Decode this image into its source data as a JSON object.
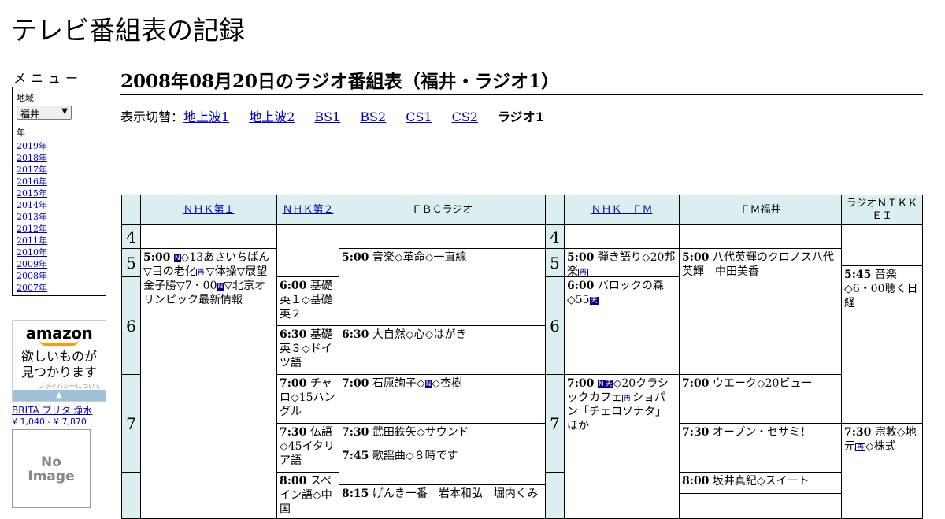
{
  "site_title": "テレビ番組表の記録",
  "menu": {
    "title": "メニュー",
    "region_label": "地域",
    "region_value": "福井",
    "year_label": "年",
    "years": [
      "2019年",
      "2018年",
      "2017年",
      "2016年",
      "2015年",
      "2014年",
      "2013年",
      "2012年",
      "2011年",
      "2010年",
      "2009年",
      "2008年",
      "2007年"
    ]
  },
  "ad": {
    "logo": "amazon",
    "copy_line1": "欲しいものが",
    "copy_line2": "見つかります",
    "privacy": "プライバシーについて",
    "product_link": "BRITA ブリタ 浄水",
    "product_price": "¥ 1,040 - ¥ 7,870",
    "noimage_line1": "No",
    "noimage_line2": "Image"
  },
  "heading": "2008年08月20日のラジオ番組表（福井・ラジオ1）",
  "switcher": {
    "label": "表示切替：",
    "links": [
      "地上波1",
      "地上波2",
      "BS1",
      "BS2",
      "CS1",
      "CS2"
    ],
    "current": "ラジオ1"
  },
  "channels": [
    "ＮＨＫ第１",
    "ＮＨＫ第２",
    "ＦＢＣラジオ",
    "ＮＨＫ　ＦＭ",
    "ＦＭ福井",
    "ラジオＮＩＫＫＥＩ"
  ],
  "hours": [
    "4",
    "5",
    "6",
    "7",
    "4",
    "5",
    "6",
    "7"
  ],
  "programs": {
    "nhk1_5": {
      "time": "5:00",
      "text": "◇13あさいちばん▽目の老化",
      "text2": "▽体操▽展望 金子勝▽7・00",
      "text3": "▽北京オリンピック最新情報"
    },
    "nhk2_6a": {
      "time": "6:00",
      "text": "基礎英１◇基礎英２"
    },
    "nhk2_6b": {
      "time": "6:30",
      "text": "基礎英３◇ドイツ語"
    },
    "nhk2_7a": {
      "time": "7:00",
      "text": "チャロ◇15ハングル"
    },
    "nhk2_7b": {
      "time": "7:30",
      "text": "仏語◇45イタリア語"
    },
    "nhk2_8a": {
      "time": "8:00",
      "text": "スペイン語◇中国"
    },
    "fbc_5": {
      "time": "5:00",
      "text": "音楽◇革命◇一直線"
    },
    "fbc_6": {
      "time": "6:30",
      "text": "大自然◇心◇はがき"
    },
    "fbc_7a": {
      "time": "7:00",
      "text": "石原詢子◇",
      "text2": "◇杏樹"
    },
    "fbc_7b": {
      "time": "7:30",
      "text": "武田鉄矢◇サウンド"
    },
    "fbc_7c": {
      "time": "7:45",
      "text": "歌謡曲◇８時です"
    },
    "fbc_8": {
      "time": "8:15",
      "text": "げんき一番　岩本和弘　堀内くみ"
    },
    "fm_5": {
      "time": "5:00",
      "text": "弾き語り◇20邦楽"
    },
    "fm_6": {
      "time": "6:00",
      "text": "バロックの森◇55"
    },
    "fm_7": {
      "time": "7:00",
      "text": "◇20クラシックカフェ",
      "text2": "ショパン「チェロソナタ」ほか"
    },
    "fmf_5": {
      "time": "5:00",
      "text": "八代英輝のクロノス八代英輝　中田美香"
    },
    "fmf_7a": {
      "time": "7:00",
      "text": "ウエーク◇20ビュー"
    },
    "fmf_7b": {
      "time": "7:30",
      "text": "オープン・セサミ！"
    },
    "fmf_8": {
      "time": "8:00",
      "text": "坂井真紀◇スイート"
    },
    "nk_5": {
      "time": "5:45",
      "text": "音楽◇6・00聴く日経"
    },
    "nk_7": {
      "time": "7:30",
      "text": "宗教◇地元",
      "text2": "◇株式"
    }
  },
  "marks": {
    "news": "N",
    "rerun": "再",
    "stereo": "天"
  },
  "colors": {
    "header_bg": "#dbeff1",
    "link": "#0000cc",
    "mark": "#00008b"
  }
}
